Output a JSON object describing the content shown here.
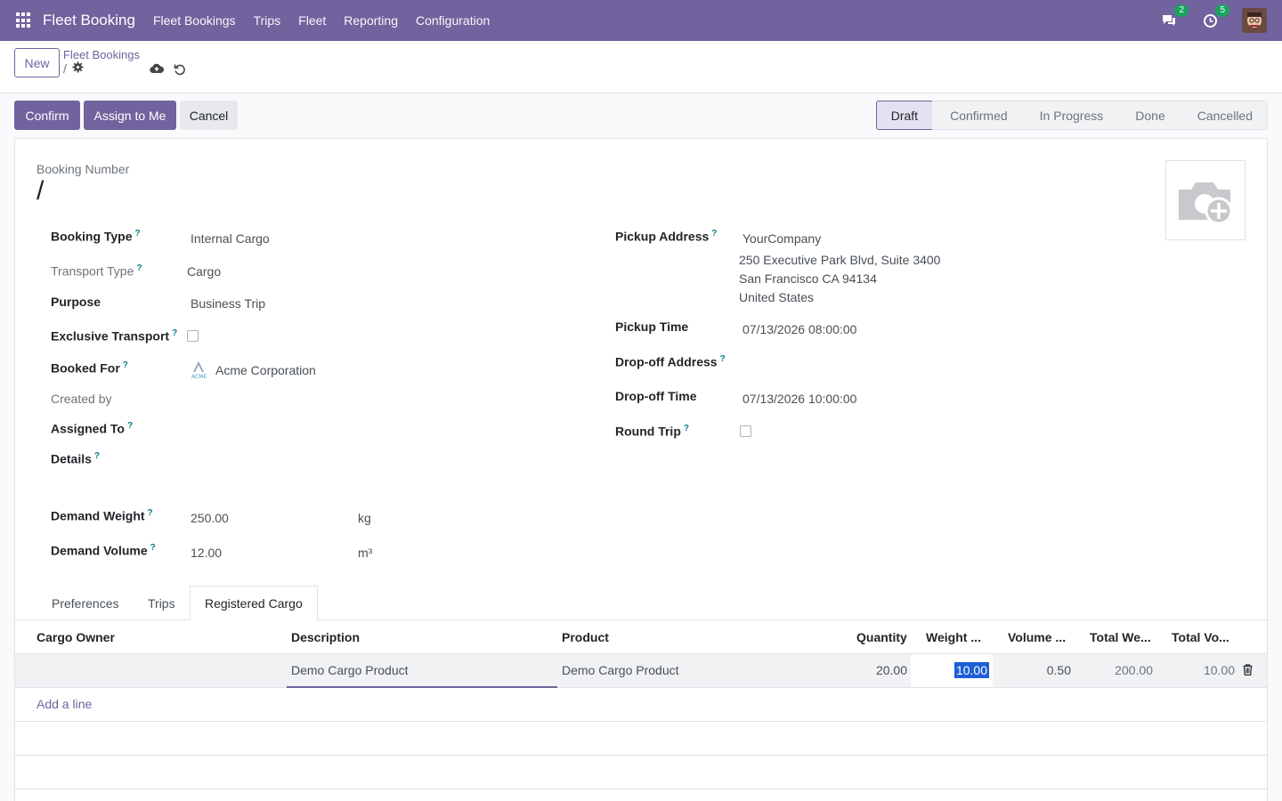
{
  "navbar": {
    "app_name": "Fleet Booking",
    "menu": [
      "Fleet Bookings",
      "Trips",
      "Fleet",
      "Reporting",
      "Configuration"
    ],
    "messages_count": "2",
    "activities_count": "5",
    "accent": "#71639e"
  },
  "control": {
    "new_label": "New",
    "breadcrumb": "Fleet Bookings",
    "record_name": "/"
  },
  "actions": {
    "confirm": "Confirm",
    "assign": "Assign to Me",
    "cancel": "Cancel"
  },
  "stages": [
    "Draft",
    "Confirmed",
    "In Progress",
    "Done",
    "Cancelled"
  ],
  "active_stage": "Draft",
  "form": {
    "booking_number_label": "Booking Number",
    "booking_number": "/",
    "left": {
      "booking_type_label": "Booking Type",
      "booking_type": "Internal Cargo",
      "transport_type_label": "Transport Type",
      "transport_type": "Cargo",
      "purpose_label": "Purpose",
      "purpose": "Business Trip",
      "exclusive_label": "Exclusive Transport",
      "booked_for_label": "Booked For",
      "booked_for": "Acme Corporation",
      "created_by_label": "Created by",
      "assigned_to_label": "Assigned To",
      "details_label": "Details",
      "demand_weight_label": "Demand Weight",
      "demand_weight": "250.00",
      "weight_unit": "kg",
      "demand_volume_label": "Demand Volume",
      "demand_volume": "12.00",
      "volume_unit": "m³"
    },
    "right": {
      "pickup_address_label": "Pickup Address",
      "pickup_company": "YourCompany",
      "pickup_line1": "250 Executive Park Blvd, Suite 3400",
      "pickup_line2": "San Francisco CA 94134",
      "pickup_line3": "United States",
      "pickup_time_label": "Pickup Time",
      "pickup_time": "07/13/2026 08:00:00",
      "dropoff_address_label": "Drop-off Address",
      "dropoff_time_label": "Drop-off Time",
      "dropoff_time": "07/13/2026 10:00:00",
      "round_trip_label": "Round Trip"
    }
  },
  "tabs": [
    "Preferences",
    "Trips",
    "Registered Cargo"
  ],
  "active_tab": "Registered Cargo",
  "table": {
    "headers": [
      "Cargo Owner",
      "Description",
      "Product",
      "Quantity",
      "Weight ...",
      "Volume ...",
      "Total We...",
      "Total Vo..."
    ],
    "rows": [
      {
        "cargo_owner": "",
        "description": "Demo Cargo Product",
        "product": "Demo Cargo Product",
        "quantity": "20.00",
        "weight": "10.00",
        "volume": "0.50",
        "total_weight": "200.00",
        "total_volume": "10.00"
      }
    ],
    "add_line": "Add a line"
  }
}
